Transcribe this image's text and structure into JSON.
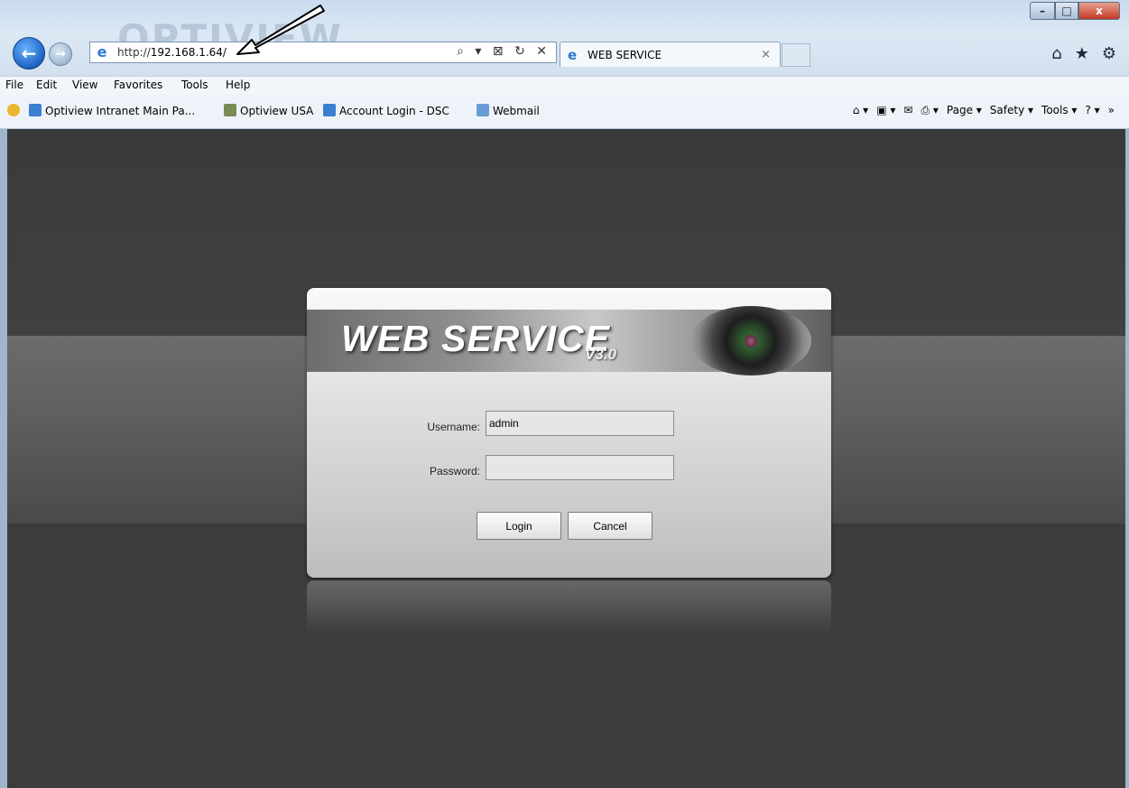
{
  "browser": {
    "url_prefix": "http://",
    "url_host": "192.168.1.64/",
    "address_tools": "⌕ ▾ ⊠ ↻ ✕",
    "tab_title": "WEB SERVICE",
    "tab_close": "×",
    "window_buttons": {
      "minimize": "–",
      "maximize": "□",
      "close": "x"
    },
    "chrome_icons": {
      "home": "⌂",
      "favorites": "★",
      "settings": "⚙"
    }
  },
  "menu": [
    "File",
    "Edit",
    "View",
    "Favorites",
    "Tools",
    "Help"
  ],
  "favorites": [
    {
      "label": "Optiview Intranet Main Pa...",
      "icon": "ie-page-icon",
      "color": "#3b7fd0"
    },
    {
      "label": "Optiview USA",
      "icon": "optiview-icon",
      "color": "#7a8a55"
    },
    {
      "label": "Account Login - DSC",
      "icon": "ie-page-icon",
      "color": "#3b7fd0"
    },
    {
      "label": "Webmail",
      "icon": "mail-icon",
      "color": "#6b9bd6"
    }
  ],
  "command_bar": {
    "page": "Page ▾",
    "safety": "Safety ▾",
    "tools": "Tools ▾",
    "help": "? ▾",
    "home": "⌂ ▾",
    "feeds": "▣ ▾",
    "mail": "✉",
    "print": "⎙ ▾",
    "overflow": "»"
  },
  "login": {
    "banner_title": "WEB  SERVICE",
    "banner_version": "V3.0",
    "username_label": "Username:",
    "username_value": "admin",
    "password_label": "Password:",
    "password_value": "",
    "login_button": "Login",
    "cancel_button": "Cancel"
  },
  "colors": {
    "page_background": "#3c3c3c",
    "close_button": "#c23a24",
    "back_button": "#1e63c4"
  }
}
